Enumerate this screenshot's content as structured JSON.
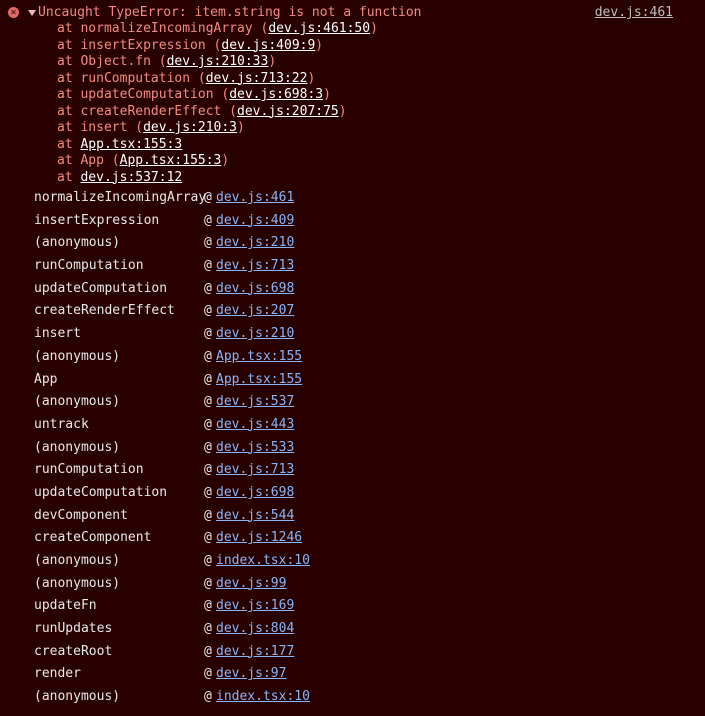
{
  "error": {
    "message": "Uncaught TypeError: item.string is not a function",
    "source": "dev.js:461",
    "icon": "error-circle-icon",
    "colors": {
      "background": "#290000",
      "message": "#f28b82",
      "link": "#8ab4f8"
    },
    "stack": [
      {
        "prefix": "at normalizeIncomingArray (",
        "link": "dev.js:461:50",
        "suffix": ")"
      },
      {
        "prefix": "at insertExpression (",
        "link": "dev.js:409:9",
        "suffix": ")"
      },
      {
        "prefix": "at Object.fn (",
        "link": "dev.js:210:33",
        "suffix": ")"
      },
      {
        "prefix": "at runComputation (",
        "link": "dev.js:713:22",
        "suffix": ")"
      },
      {
        "prefix": "at updateComputation (",
        "link": "dev.js:698:3",
        "suffix": ")"
      },
      {
        "prefix": "at createRenderEffect (",
        "link": "dev.js:207:75",
        "suffix": ")"
      },
      {
        "prefix": "at insert (",
        "link": "dev.js:210:3",
        "suffix": ")"
      },
      {
        "prefix": "at ",
        "link": "App.tsx:155:3",
        "suffix": ""
      },
      {
        "prefix": "at App (",
        "link": "App.tsx:155:3",
        "suffix": ")"
      },
      {
        "prefix": "at ",
        "link": "dev.js:537:12",
        "suffix": ""
      }
    ]
  },
  "trace": [
    {
      "fn": "normalizeIncomingArray",
      "at": "@",
      "link": "dev.js:461"
    },
    {
      "fn": "insertExpression",
      "at": "@",
      "link": "dev.js:409"
    },
    {
      "fn": "(anonymous)",
      "at": "@",
      "link": "dev.js:210"
    },
    {
      "fn": "runComputation",
      "at": "@",
      "link": "dev.js:713"
    },
    {
      "fn": "updateComputation",
      "at": "@",
      "link": "dev.js:698"
    },
    {
      "fn": "createRenderEffect",
      "at": "@",
      "link": "dev.js:207"
    },
    {
      "fn": "insert",
      "at": "@",
      "link": "dev.js:210"
    },
    {
      "fn": "(anonymous)",
      "at": "@",
      "link": "App.tsx:155"
    },
    {
      "fn": "App",
      "at": "@",
      "link": "App.tsx:155"
    },
    {
      "fn": "(anonymous)",
      "at": "@",
      "link": "dev.js:537"
    },
    {
      "fn": "untrack",
      "at": "@",
      "link": "dev.js:443"
    },
    {
      "fn": "(anonymous)",
      "at": "@",
      "link": "dev.js:533"
    },
    {
      "fn": "runComputation",
      "at": "@",
      "link": "dev.js:713"
    },
    {
      "fn": "updateComputation",
      "at": "@",
      "link": "dev.js:698"
    },
    {
      "fn": "devComponent",
      "at": "@",
      "link": "dev.js:544"
    },
    {
      "fn": "createComponent",
      "at": "@",
      "link": "dev.js:1246"
    },
    {
      "fn": "(anonymous)",
      "at": "@",
      "link": "index.tsx:10"
    },
    {
      "fn": "(anonymous)",
      "at": "@",
      "link": "dev.js:99"
    },
    {
      "fn": "updateFn",
      "at": "@",
      "link": "dev.js:169"
    },
    {
      "fn": "runUpdates",
      "at": "@",
      "link": "dev.js:804"
    },
    {
      "fn": "createRoot",
      "at": "@",
      "link": "dev.js:177"
    },
    {
      "fn": "render",
      "at": "@",
      "link": "dev.js:97"
    },
    {
      "fn": "(anonymous)",
      "at": "@",
      "link": "index.tsx:10"
    }
  ]
}
